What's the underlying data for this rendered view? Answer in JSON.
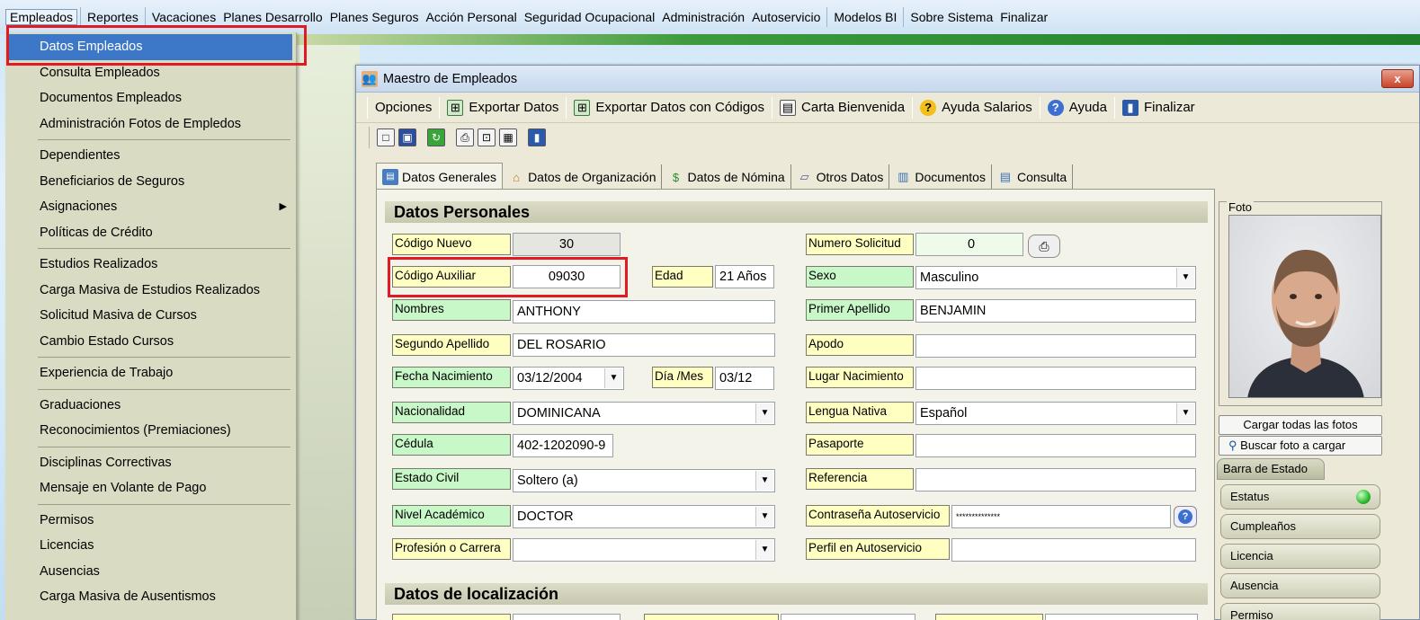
{
  "menubar": [
    "Empleados",
    "Reportes",
    "Vacaciones",
    "Planes Desarrollo",
    "Planes Seguros",
    "Acción Personal",
    "Seguridad Ocupacional",
    "Administración",
    "Autoservicio",
    "Modelos BI",
    "Sobre Sistema",
    "Finalizar"
  ],
  "dropdown": {
    "items": [
      "Datos Empleados",
      "Consulta Empleados",
      "Documentos Empleados",
      "Administración Fotos de Empledos",
      "Dependientes",
      "Beneficiarios de Seguros",
      "Asignaciones",
      "Políticas de Crédito",
      "Estudios Realizados",
      "Carga Masiva de Estudios Realizados",
      "Solicitud Masiva de Cursos",
      "Cambio Estado Cursos",
      "Experiencia de Trabajo",
      "Graduaciones",
      "Reconocimientos (Premiaciones)",
      "Disciplinas Correctivas",
      "Mensaje en Volante de Pago",
      "Permisos",
      "Licencias",
      "Ausencias",
      "Carga Masiva de Ausentismos"
    ]
  },
  "window": {
    "title": "Maestro de Empleados",
    "close": "x",
    "toolbar": [
      "Opciones",
      "Exportar Datos",
      "Exportar Datos con Códigos",
      "Carta Bienvenida",
      "Ayuda Salarios",
      "Ayuda",
      "Finalizar"
    ],
    "tabs": [
      "Datos Generales",
      "Datos de Organización",
      "Datos de Nómina",
      "Otros Datos",
      "Documentos",
      "Consulta"
    ]
  },
  "form": {
    "section1": "Datos Personales",
    "section2": "Datos de localización",
    "labels": {
      "codigo_nuevo": "Código Nuevo",
      "codigo_auxiliar": "Código Auxiliar",
      "edad": "Edad",
      "nombres": "Nombres",
      "segundo_apellido": "Segundo Apellido",
      "fecha_nacimiento": "Fecha Nacimiento",
      "dia_mes": "Día /Mes",
      "nacionalidad": "Nacionalidad",
      "cedula": "Cédula",
      "estado_civil": "Estado Civil",
      "nivel_academico": "Nivel Académico",
      "profesion": "Profesión o Carrera",
      "numero_solicitud": "Numero Solicitud",
      "sexo": "Sexo",
      "primer_apellido": "Primer Apellido",
      "apodo": "Apodo",
      "lugar_nacimiento": "Lugar Nacimiento",
      "lengua_nativa": "Lengua Nativa",
      "pasaporte": "Pasaporte",
      "referencia": "Referencia",
      "contrasena": "Contraseña Autoservicio",
      "perfil": "Perfil en Autoservicio"
    },
    "values": {
      "codigo_nuevo": "30",
      "codigo_auxiliar": "09030",
      "edad": "21 Años",
      "nombres": "ANTHONY",
      "segundo_apellido": "DEL ROSARIO",
      "fecha_nacimiento": "03/12/2004",
      "dia_mes": "03/12",
      "nacionalidad": "DOMINICANA",
      "cedula": "402-1202090-9",
      "estado_civil": "Soltero (a)",
      "nivel_academico": "DOCTOR",
      "profesion": "",
      "numero_solicitud": "0",
      "sexo": "Masculino",
      "primer_apellido": "BENJAMIN",
      "apodo": "",
      "lugar_nacimiento": "",
      "lengua_nativa": "Español",
      "pasaporte": "",
      "referencia": "",
      "contrasena": "**************",
      "perfil": ""
    }
  },
  "right_panel": {
    "foto": "Foto",
    "cargar_todas": "Cargar todas las fotos",
    "buscar_foto": "Buscar foto a cargar",
    "barra_estado": "Barra de Estado",
    "status_items": [
      "Estatus",
      "Cumpleaños",
      "Licencia",
      "Ausencia",
      "Permiso"
    ]
  }
}
